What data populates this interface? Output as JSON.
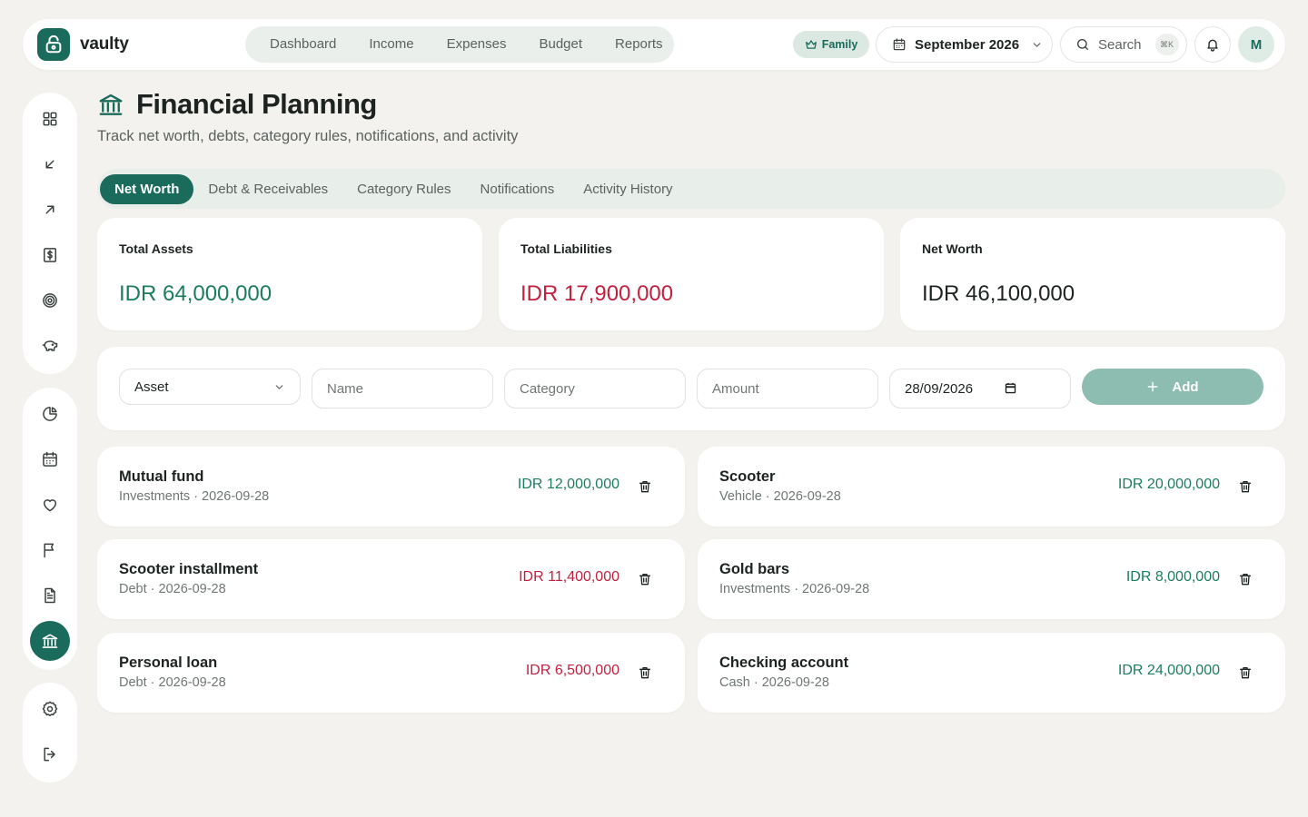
{
  "app": {
    "name": "vaulty"
  },
  "nav": {
    "items": [
      "Dashboard",
      "Income",
      "Expenses",
      "Budget",
      "Reports"
    ]
  },
  "topbar": {
    "family_label": "Family",
    "month": "September 2026",
    "search_label": "Search",
    "search_shortcut": "⌘K",
    "avatar_initial": "M"
  },
  "page": {
    "title": "Financial Planning",
    "subtitle": "Track net worth, debts, category rules, notifications, and activity"
  },
  "tabs": [
    "Net Worth",
    "Debt & Receivables",
    "Category Rules",
    "Notifications",
    "Activity History"
  ],
  "stats": {
    "assets": {
      "label": "Total Assets",
      "value": "IDR 64,000,000"
    },
    "liabilities": {
      "label": "Total Liabilities",
      "value": "IDR 17,900,000"
    },
    "networth": {
      "label": "Net Worth",
      "value": "IDR 46,100,000"
    }
  },
  "form": {
    "type_value": "Asset",
    "name_placeholder": "Name",
    "category_placeholder": "Category",
    "amount_placeholder": "Amount",
    "date_value": "28/09/2026",
    "add_label": "Add"
  },
  "entries": [
    {
      "name": "Mutual fund",
      "meta": "Investments · 2026-09-28",
      "amount": "IDR 12,000,000",
      "kind": "asset"
    },
    {
      "name": "Scooter",
      "meta": "Vehicle · 2026-09-28",
      "amount": "IDR 20,000,000",
      "kind": "asset"
    },
    {
      "name": "Scooter installment",
      "meta": "Debt · 2026-09-28",
      "amount": "IDR 11,400,000",
      "kind": "liability"
    },
    {
      "name": "Gold bars",
      "meta": "Investments · 2026-09-28",
      "amount": "IDR 8,000,000",
      "kind": "asset"
    },
    {
      "name": "Personal loan",
      "meta": "Debt · 2026-09-28",
      "amount": "IDR 6,500,000",
      "kind": "liability"
    },
    {
      "name": "Checking account",
      "meta": "Cash · 2026-09-28",
      "amount": "IDR 24,000,000",
      "kind": "asset"
    }
  ],
  "colors": {
    "brand": "#1b6b5d",
    "positive": "#1b7c5e",
    "negative": "#c2203f",
    "background": "#f3f2ee"
  },
  "sidebar": {
    "icons": [
      "grid-icon",
      "arrow-down-left-icon",
      "arrow-up-right-icon",
      "dollar-icon",
      "target-icon",
      "piggy-bank-icon",
      "pie-chart-icon",
      "calendar-icon",
      "heart-icon",
      "flag-icon",
      "document-icon",
      "bank-icon",
      "settings-icon",
      "logout-icon"
    ],
    "active": "bank-icon"
  }
}
